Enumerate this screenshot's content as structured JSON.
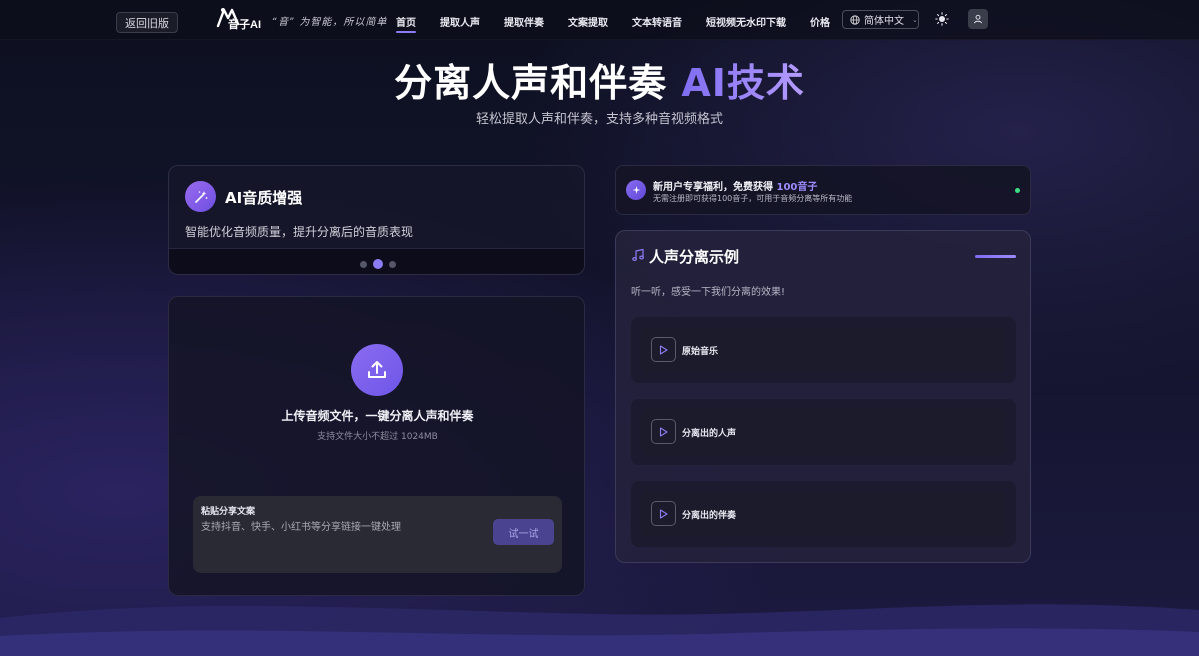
{
  "header": {
    "old_version": "返回旧版",
    "logo_text": "音子AI",
    "slogan": "“音” 为智能，所以简单",
    "nav": [
      {
        "label": "首页",
        "active": true
      },
      {
        "label": "提取人声"
      },
      {
        "label": "提取伴奏"
      },
      {
        "label": "文案提取"
      },
      {
        "label": "文本转语音"
      },
      {
        "label": "短视频无水印下载"
      },
      {
        "label": "价格"
      }
    ],
    "language": "简体中文"
  },
  "hero": {
    "title_main": "分离人声和伴奏",
    "title_accent": "AI技术",
    "subtitle": "轻松提取人声和伴奏，支持多种音视频格式"
  },
  "feature": {
    "title": "AI音质增强",
    "description": "智能优化音频质量，提升分离后的音质表现",
    "carousel_active": 2,
    "carousel_count": 3
  },
  "upload": {
    "title": "上传音频文件，一键分离人声和伴奏",
    "limit": "支持文件大小不超过 1024MB",
    "share_label": "粘贴分享文案",
    "share_placeholder": "支持抖音、快手、小红书等分享链接一键处理",
    "try_button": "试一试"
  },
  "promo": {
    "title_prefix": "新用户专享福利，免费获得 ",
    "title_highlight": "100音子",
    "subtitle": "无需注册即可获得100音子，可用于音频分离等所有功能"
  },
  "examples": {
    "title": "人声分离示例",
    "subtitle": "听一听，感受一下我们分离的效果!",
    "tracks": [
      {
        "label": "原始音乐"
      },
      {
        "label": "分离出的人声"
      },
      {
        "label": "分离出的伴奏"
      }
    ]
  },
  "colors": {
    "accent": "#8b7cf6",
    "promo_status": "#3ddc84"
  }
}
